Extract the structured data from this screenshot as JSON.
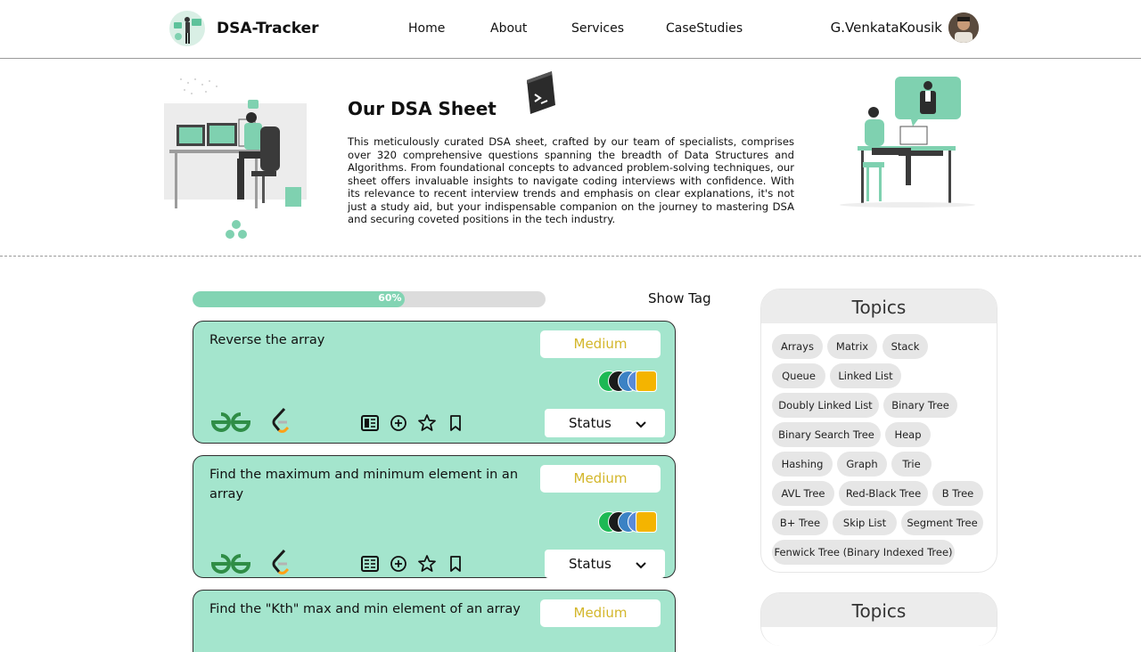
{
  "nav": {
    "brand": "DSA-Tracker",
    "links": [
      "Home",
      "About",
      "Services",
      "CaseStudies"
    ],
    "user_name": "G.VenkataKousik"
  },
  "hero": {
    "title": "Our DSA Sheet",
    "description": "This meticulously curated DSA sheet, crafted by our team of specialists, comprises over 320 comprehensive questions spanning the breadth of Data Structures and Algorithms. From foundational concepts to advanced problem-solving techniques, our sheet offers invaluable insights to navigate coding interviews with confidence. With its relevance to recent interview trends and emphasis on clear explanations, it's not just a study aid, but your indispensable companion on the journey to mastering DSA and securing coveted positions in the tech industry."
  },
  "progress": {
    "percent": 60,
    "label": "60%"
  },
  "show_tag": "Show Tag",
  "questions": [
    {
      "title": "Reverse the array",
      "difficulty": "Medium",
      "status": "Status"
    },
    {
      "title": "Find the maximum and minimum element in an array",
      "difficulty": "Medium",
      "status": "Status"
    },
    {
      "title": "Find the \"Kth\" max and min element of an array",
      "difficulty": "Medium",
      "status": "Status"
    }
  ],
  "topics": {
    "heading": "Topics",
    "items": [
      "Arrays",
      "Matrix",
      "Stack",
      "Queue",
      "Linked List",
      "Doubly Linked List",
      "Binary Tree",
      "Binary Search Tree",
      "Heap",
      "Hashing",
      "Graph",
      "Trie",
      "AVL Tree",
      "Red-Black Tree",
      "B Tree",
      "B+ Tree",
      "Skip List",
      "Segment Tree",
      "Fenwick Tree (Binary Indexed Tree)"
    ]
  },
  "topics2": {
    "heading": "Topics"
  },
  "colors": {
    "accent": "#82d4b3",
    "card": "#a4e5cd",
    "difficulty_medium": "#d3b62a",
    "gfg_green": "#2f8d46",
    "leetcode_orange": "#ffa116"
  }
}
